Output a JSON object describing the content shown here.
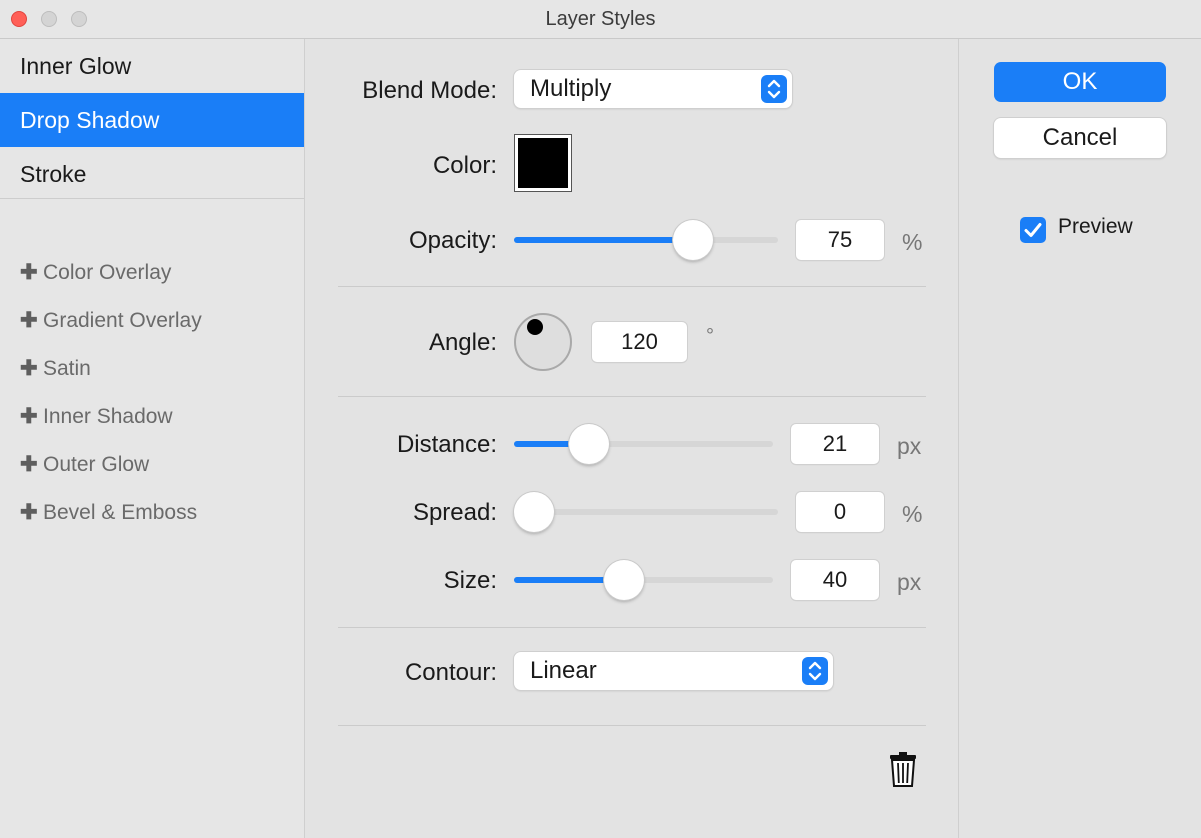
{
  "window": {
    "title": "Layer Styles"
  },
  "sidebar": {
    "items": [
      {
        "label": "Inner Glow",
        "selected": false
      },
      {
        "label": "Drop Shadow",
        "selected": true
      },
      {
        "label": "Stroke",
        "selected": false
      }
    ],
    "add_items": [
      "Color Overlay",
      "Gradient Overlay",
      "Satin",
      "Inner Shadow",
      "Outer Glow",
      "Bevel & Emboss"
    ]
  },
  "main": {
    "blend_mode": {
      "label": "Blend Mode:",
      "value": "Multiply"
    },
    "color": {
      "label": "Color:",
      "value": "#000000"
    },
    "opacity": {
      "label": "Opacity:",
      "value": "75",
      "unit": "%",
      "fraction": 0.71
    },
    "angle": {
      "label": "Angle:",
      "value": "120",
      "unit": "°"
    },
    "distance": {
      "label": "Distance:",
      "value": "21",
      "unit": "px",
      "fraction": 0.25
    },
    "spread": {
      "label": "Spread:",
      "value": "0",
      "unit": "%",
      "fraction": 0.0
    },
    "size": {
      "label": "Size:",
      "value": "40",
      "unit": "px",
      "fraction": 0.41
    },
    "contour": {
      "label": "Contour:",
      "value": "Linear"
    }
  },
  "actions": {
    "ok_label": "OK",
    "cancel_label": "Cancel",
    "preview_label": "Preview",
    "preview_checked": true
  },
  "colors": {
    "accent": "#1a7ef7"
  },
  "icons": {
    "delete": "trash-icon",
    "popup": "up-down-chevron-icon"
  }
}
